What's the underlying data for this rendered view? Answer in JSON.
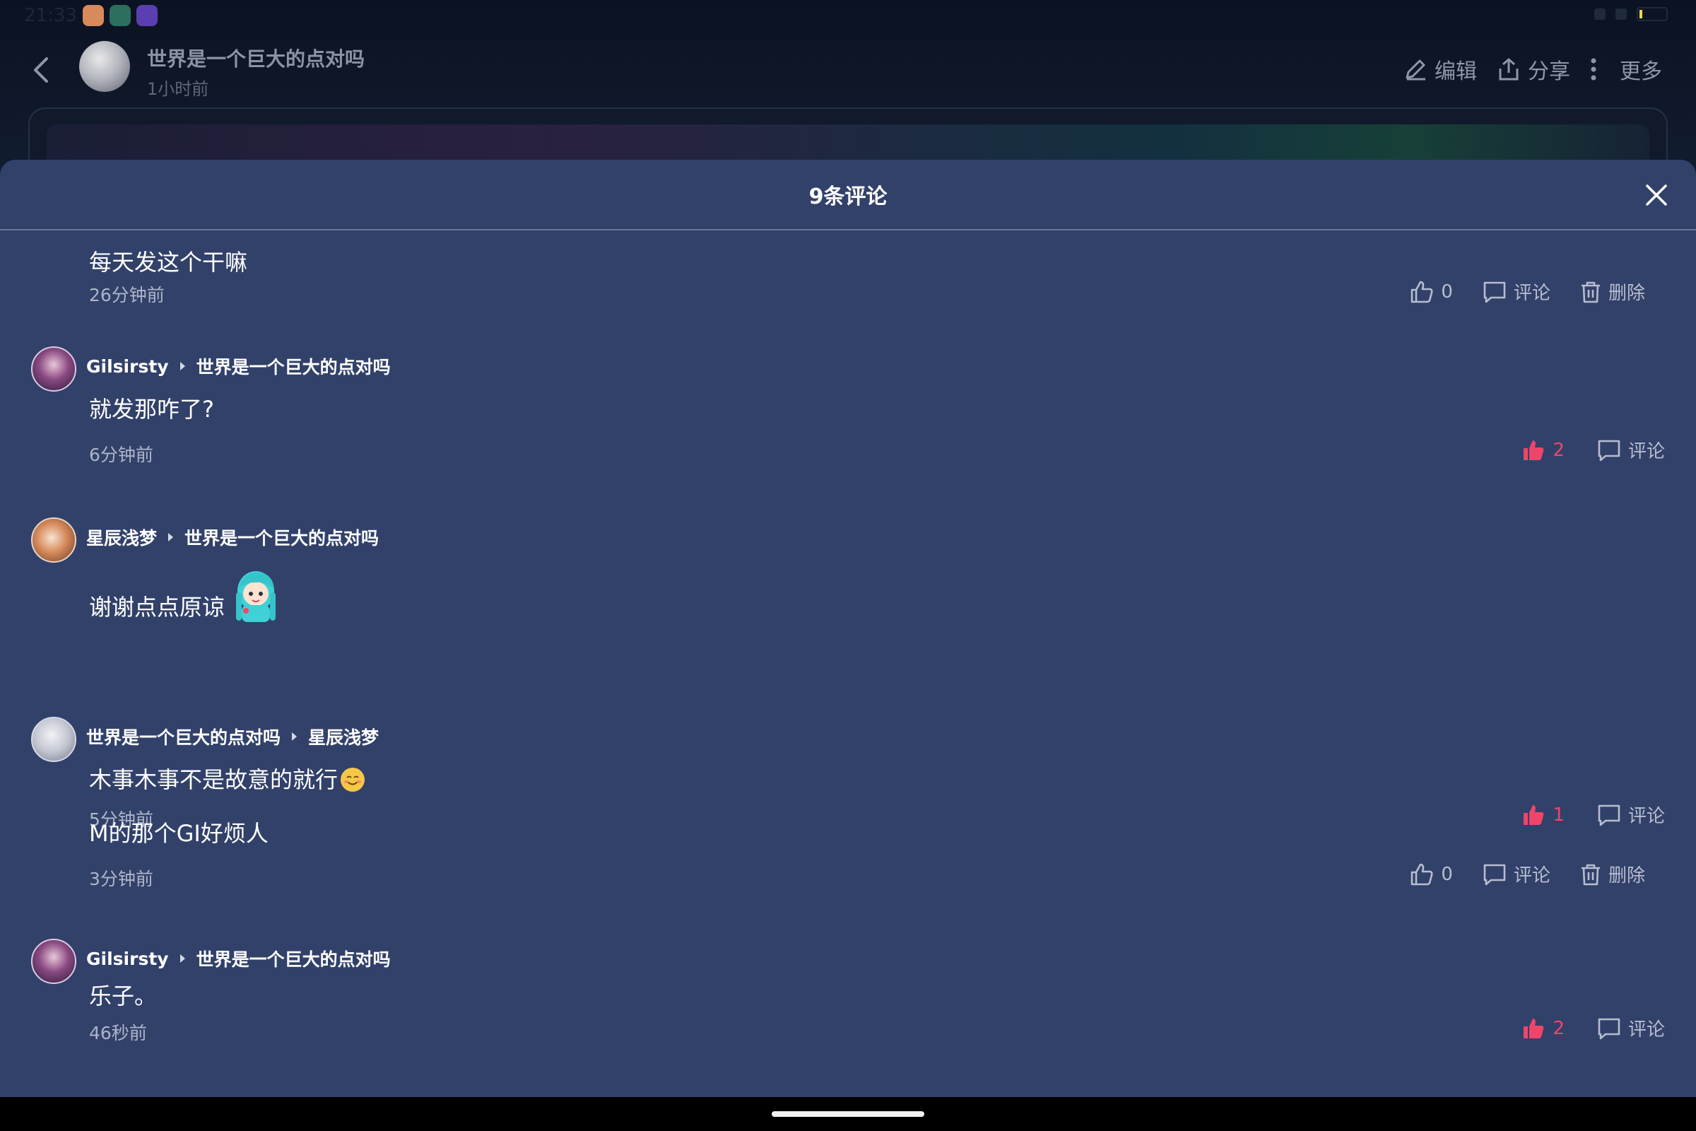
{
  "status_bar": {
    "time": "21:33"
  },
  "top_bar": {
    "author_name": "世界是一个巨大的点对吗",
    "post_time": "1小时前",
    "edit_label": "编辑",
    "share_label": "分享",
    "more_label": "更多"
  },
  "sheet": {
    "title": "9条评论"
  },
  "comments": [
    {
      "text": "每天发这个干嘛",
      "time": "26分钟前",
      "like_count": "0",
      "reply_label": "评论",
      "delete_label": "删除"
    },
    {
      "author": "Gilsirsty",
      "reply_to": "世界是一个巨大的点对吗",
      "text": "就发那咋了?",
      "time": "6分钟前",
      "like_count": "2",
      "reply_label": "评论"
    },
    {
      "author": "星辰浅梦",
      "reply_to": "世界是一个巨大的点对吗",
      "text": "谢谢点点原谅",
      "sticker_icon": "anime-girl-sticker",
      "time": "5分钟前",
      "like_count": "1",
      "reply_label": "评论"
    },
    {
      "author": "世界是一个巨大的点对吗",
      "reply_to": "星辰浅梦",
      "text": "木事木事不是故意的就行",
      "text_line2": "M的那个GI好烦人",
      "emoji_icon": "smiling-face-emoji",
      "time": "3分钟前",
      "like_count": "0",
      "reply_label": "评论",
      "delete_label": "删除"
    },
    {
      "author": "Gilsirsty",
      "reply_to": "世界是一个巨大的点对吗",
      "text": "乐子。",
      "time": "46秒前",
      "like_count": "2",
      "reply_label": "评论"
    }
  ],
  "colors": {
    "sheet_bg": "#32416a",
    "liked": "#f0456a",
    "muted_text": "#aeb5c8"
  }
}
